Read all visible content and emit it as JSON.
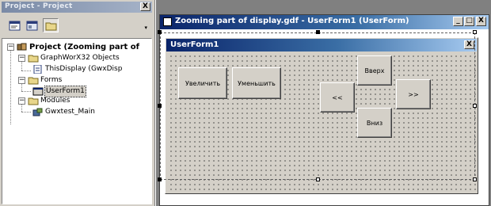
{
  "project_explorer": {
    "title": "Project - Project",
    "close_label": "X",
    "dropdown_label": "▾",
    "toolbar": [
      "view-code",
      "view-object",
      "toggle-folders"
    ],
    "tree": {
      "root": "Project (Zooming part of",
      "graphworx": "GraphWorX32 Objects",
      "thisdisplay": "ThisDisplay (GwxDisp",
      "forms": "Forms",
      "userform": "UserForm1",
      "modules": "Modules",
      "module1": "Gwxtest_Main"
    }
  },
  "designer": {
    "title": "Zooming part of display.gdf - UserForm1 (UserForm)",
    "minimize": "_",
    "restore": "□",
    "close": "X"
  },
  "userform": {
    "title": "UserForm1",
    "close": "X",
    "buttons": {
      "zoom_in": "Увеличить",
      "zoom_out": "Уменьшить",
      "up": "Вверх",
      "left": "<<",
      "right": ">>",
      "down": "Вниз"
    }
  },
  "colors": {
    "title_active": "#0a246a",
    "face": "#d4d0c8",
    "workspace": "#808080"
  }
}
